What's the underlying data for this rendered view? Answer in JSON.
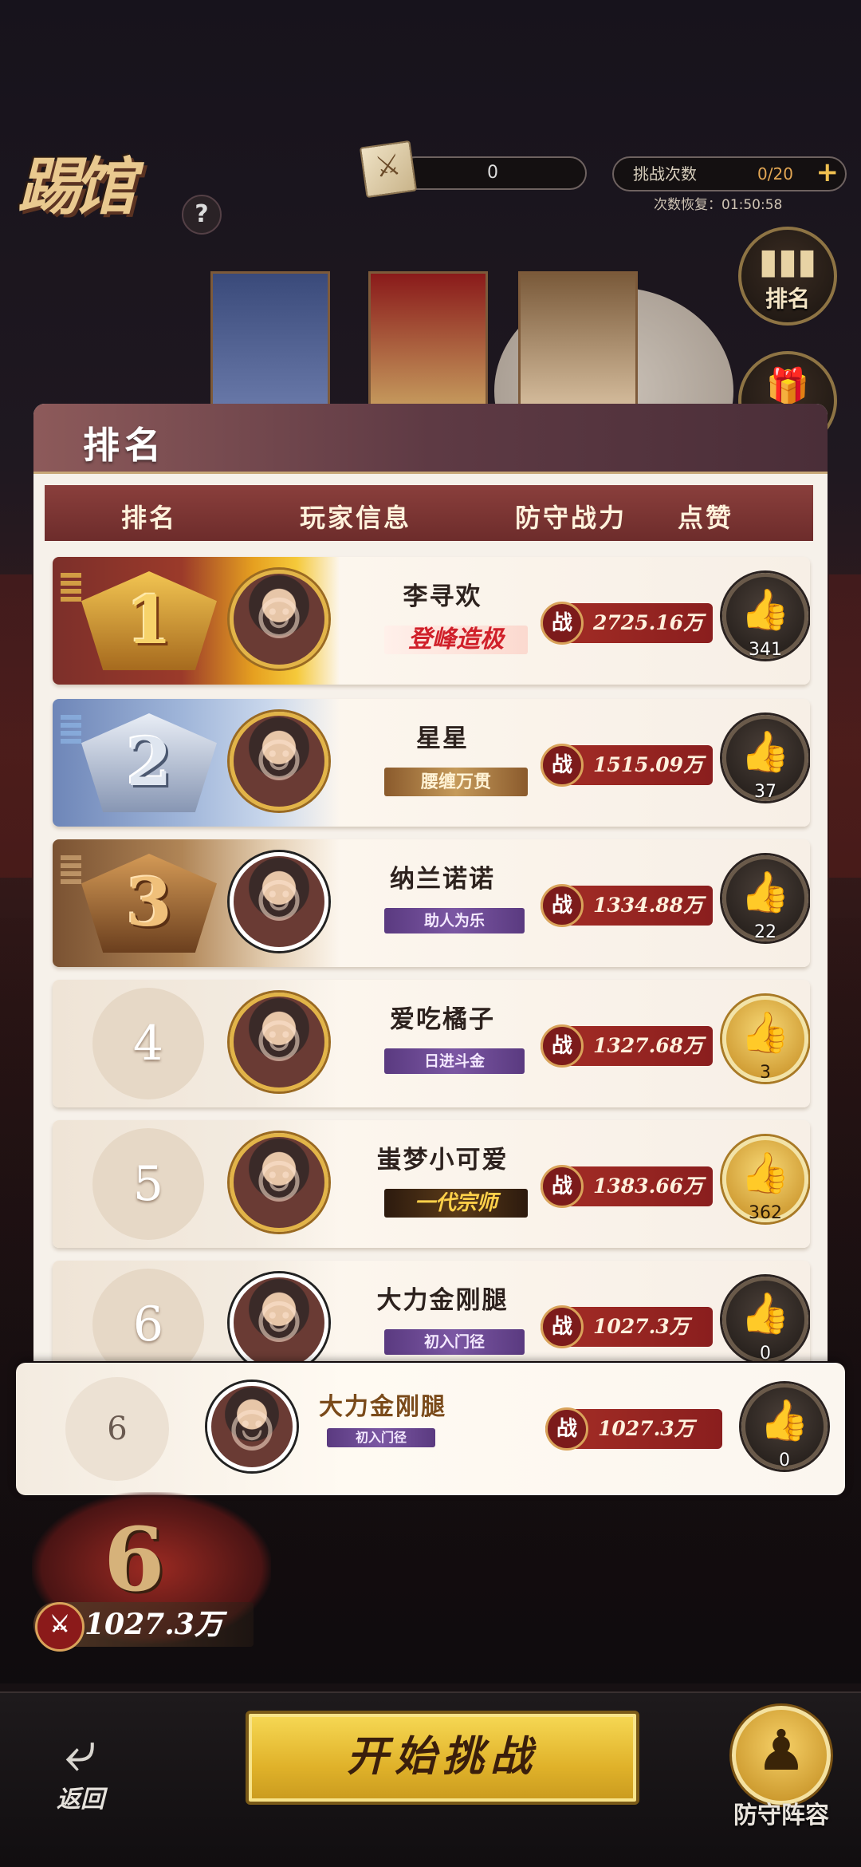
{
  "header": {
    "logo_text": "踢馆",
    "help_label": "?",
    "ticket_value": "0",
    "challenge_label": "挑战次数",
    "challenge_count": "0/20",
    "challenge_plus": "+",
    "recover_text": "次数恢复：01:50:58"
  },
  "side_buttons": {
    "ranking": "排名"
  },
  "panel": {
    "title": "排名",
    "columns": [
      "排名",
      "玩家信息",
      "防守战力",
      "点赞"
    ],
    "power_prefix": "战"
  },
  "rows": [
    {
      "rank": "1",
      "name": "李寻欢",
      "title": "登峰造极",
      "power": "2725.16万",
      "likes": "341"
    },
    {
      "rank": "2",
      "name": "星星",
      "title": "腰缠万贯",
      "power": "1515.09万",
      "likes": "37"
    },
    {
      "rank": "3",
      "name": "纳兰诺诺",
      "title": "助人为乐",
      "power": "1334.88万",
      "likes": "22"
    },
    {
      "rank": "4",
      "name": "爱吃橘子",
      "title": "日进斗金",
      "power": "1327.68万",
      "likes": "3"
    },
    {
      "rank": "5",
      "name": "蚩梦小可爱",
      "title": "一代宗师",
      "power": "1383.66万",
      "likes": "362"
    },
    {
      "rank": "6",
      "name": "大力金刚腿",
      "title": "初入门径",
      "power": "1027.3万",
      "likes": "0"
    }
  ],
  "my_row": {
    "rank": "6",
    "name": "大力金刚腿",
    "title": "初入门径",
    "power": "1027.3万",
    "likes": "0"
  },
  "bottom": {
    "my_rank": "6",
    "my_power": "1027.3万",
    "back_label": "返回",
    "start_label": "开始挑战",
    "defense_label": "防守阵容"
  }
}
